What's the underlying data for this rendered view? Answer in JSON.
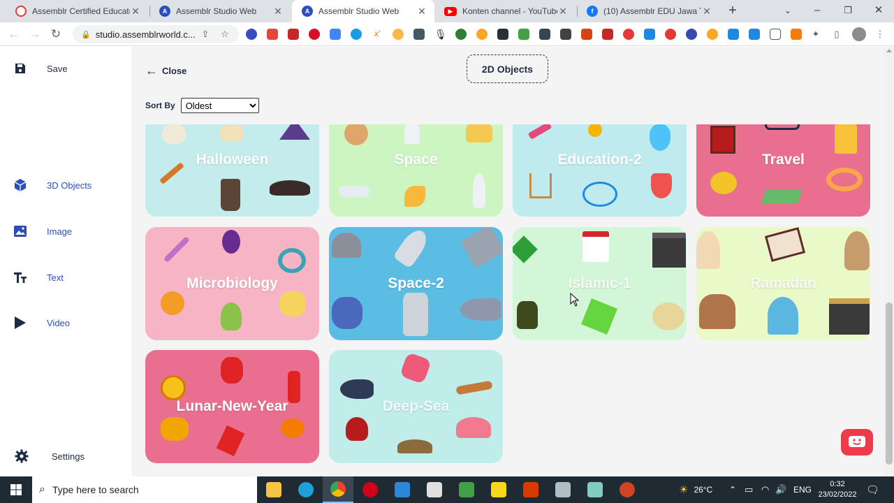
{
  "browser": {
    "tabs": [
      {
        "label": "Assemblr Certified Educator |",
        "favicon": "assemblr-edu-icon",
        "color": "#e53935"
      },
      {
        "label": "Assemblr Studio Web",
        "favicon": "assemblr-icon",
        "color": "#2b4fb8"
      },
      {
        "label": "Assemblr Studio Web",
        "favicon": "assemblr-icon",
        "color": "#2b4fb8",
        "active": true
      },
      {
        "label": "Konten channel - YouTube St",
        "favicon": "youtube-icon",
        "color": "#ff0000"
      },
      {
        "label": "(10) Assemblr EDU Jawa Teng",
        "favicon": "facebook-icon",
        "color": "#1877f2"
      }
    ],
    "url": "studio.assemblrworld.c..."
  },
  "sidebar": {
    "items": [
      {
        "label": "Save",
        "icon": "save-icon"
      },
      {
        "label": "3D Objects",
        "icon": "cube-icon"
      },
      {
        "label": "Image",
        "icon": "image-icon"
      },
      {
        "label": "Text",
        "icon": "text-icon"
      },
      {
        "label": "Video",
        "icon": "play-icon"
      },
      {
        "label": "Settings",
        "icon": "gear-icon"
      }
    ]
  },
  "main": {
    "close_label": "Close",
    "category_label": "2D Objects",
    "sort_label": "Sort By",
    "sort_value": "Oldest",
    "cards": [
      {
        "title": "Halloween",
        "color": "#c4ecec"
      },
      {
        "title": "Space",
        "color": "#cdf5c2"
      },
      {
        "title": "Education-2",
        "color": "#bfebef"
      },
      {
        "title": "Travel",
        "color": "#e8708e"
      },
      {
        "title": "Microbiology",
        "color": "#f6b4c4"
      },
      {
        "title": "Space-2",
        "color": "#5cbde4"
      },
      {
        "title": "Islamic-1",
        "color": "#d3f6d8"
      },
      {
        "title": "Ramadan",
        "color": "#eaf9c8"
      },
      {
        "title": "Lunar-New-Year",
        "color": "#e8708e"
      },
      {
        "title": "Deep-Sea",
        "color": "#bfedea"
      }
    ]
  },
  "taskbar": {
    "search_placeholder": "Type here to search",
    "weather": "26°C",
    "language": "ENG",
    "time": "0:32",
    "date": "23/02/2022"
  }
}
